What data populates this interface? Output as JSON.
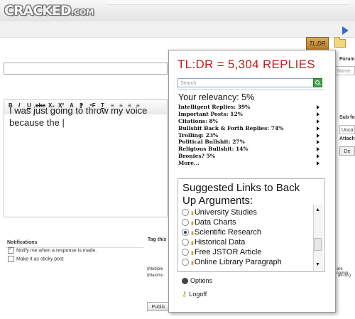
{
  "header": {
    "logo": "CRACKED",
    "logo_suffix": ".COM"
  },
  "toolbar": {
    "tldr_button": "TL:DR",
    "extra_tab": ""
  },
  "forum": {
    "forum_label": "Forum",
    "name_placeholder": "Name",
    "subforum_label": "Sub fo",
    "unca_value": "Unca",
    "attach_label": "Attach",
    "de_button": "De"
  },
  "editor": {
    "toolbar_items": [
      "B",
      "I",
      "U",
      "abc",
      "X₂",
      "X²",
      "A",
      "⁋",
      "⁹F",
      "T",
      "≡",
      "≡",
      "≡",
      "≡"
    ],
    "text": "I was just going to throw my voice because the |"
  },
  "popup": {
    "title": "TL:DR = 5,304 REPLIES",
    "search_placeholder": "Search",
    "relevancy": "Your relevancy:  5%",
    "stats": [
      "Intelligent Replies: 39%",
      "Important Posts: 12%",
      "Citations:  8%",
      "Bullshit Back & Forth Replies:  74%",
      "Trolling:  23%",
      "Political Bullshit:  27%",
      "Religious Bullshit: 14%",
      "Bronies? 5%",
      "More..."
    ],
    "suggest_title": "Suggested Links to Back Up Arguments:",
    "links": [
      {
        "label": "University Studies",
        "selected": false
      },
      {
        "label": "Data Charts",
        "selected": false
      },
      {
        "label": "Scientific Research",
        "selected": true
      },
      {
        "label": "Historical Data",
        "selected": false
      },
      {
        "label": "Free JSTOR Article",
        "selected": false
      },
      {
        "label": "Online Library Paragraph",
        "selected": false
      }
    ],
    "options": "Options",
    "logoff": "Logoff"
  },
  "notifications": {
    "title": "Notifications",
    "notify_label": "Notify me when a response is made.",
    "notify_checked": true,
    "sticky_label": "Make it as sticky post",
    "sticky_checked": false
  },
  "tagging": {
    "tag_label": "Tag this",
    "multiple_text": "(Multiple",
    "maxim_text": "(Maximu",
    "arecomm_text": "are comm",
    "ailids_text": "ail-Ids)",
    "publish_button": "Publis"
  }
}
